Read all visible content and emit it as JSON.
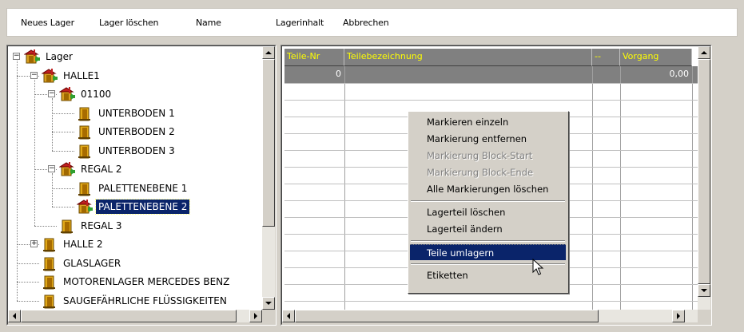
{
  "menu": {
    "items": [
      "Neues Lager",
      "Lager löschen",
      "Name",
      "Lagerinhalt",
      "Abbrechen"
    ]
  },
  "tree": {
    "nodes": [
      {
        "label": "Lager",
        "icon": "warehouse-icon",
        "expander": "minus"
      },
      {
        "label": "HALLE1",
        "icon": "warehouse-icon",
        "expander": "minus"
      },
      {
        "label": "01100",
        "icon": "warehouse-icon",
        "expander": "minus"
      },
      {
        "label": "UNTERBODEN 1",
        "icon": "storage-shelf-icon"
      },
      {
        "label": "UNTERBODEN 2",
        "icon": "storage-shelf-icon"
      },
      {
        "label": "UNTERBODEN 3",
        "icon": "storage-shelf-icon"
      },
      {
        "label": "REGAL 2",
        "icon": "warehouse-icon",
        "expander": "minus"
      },
      {
        "label": "PALETTENEBENE 1",
        "icon": "storage-shelf-icon"
      },
      {
        "label": "PALETTENEBENE 2",
        "icon": "warehouse-icon",
        "selected": true
      },
      {
        "label": "REGAL 3",
        "icon": "storage-shelf-icon"
      },
      {
        "label": "HALLE 2",
        "icon": "storage-shelf-icon",
        "expander": "plus"
      },
      {
        "label": "GLASLAGER",
        "icon": "storage-shelf-icon"
      },
      {
        "label": "MOTORENLAGER MERCEDES BENZ",
        "icon": "storage-shelf-icon"
      },
      {
        "label": "SAUGEFÄHRLICHE FLÜSSIGKEITEN",
        "icon": "storage-shelf-icon"
      }
    ]
  },
  "grid": {
    "columns": [
      "Teile-Nr",
      "Teilebezeichnung",
      "--",
      "Vorgang"
    ],
    "rows": [
      {
        "teile_nr": "0",
        "bezeichnung": "",
        "flag": "",
        "vorgang": "0,00"
      }
    ],
    "header_text_color": "#ffff00",
    "header_bg": "#808080"
  },
  "context_menu": {
    "items": [
      {
        "label": "Markieren einzeln",
        "enabled": true
      },
      {
        "label": "Markierung entfernen",
        "enabled": true
      },
      {
        "label": "Markierung Block-Start",
        "enabled": false
      },
      {
        "label": "Markierung Block-Ende",
        "enabled": false
      },
      {
        "label": "Alle Markierungen löschen",
        "enabled": true
      },
      {
        "separator": true
      },
      {
        "label": "Lagerteil löschen",
        "enabled": true
      },
      {
        "label": "Lagerteil ändern",
        "enabled": true
      },
      {
        "separator": true
      },
      {
        "label": "Teile umlagern",
        "enabled": true,
        "highlighted": true
      },
      {
        "separator": true
      },
      {
        "label": "Etiketten",
        "enabled": true
      }
    ]
  },
  "colors": {
    "selection": "#0a246a",
    "window_bg": "#d4d0c8"
  }
}
